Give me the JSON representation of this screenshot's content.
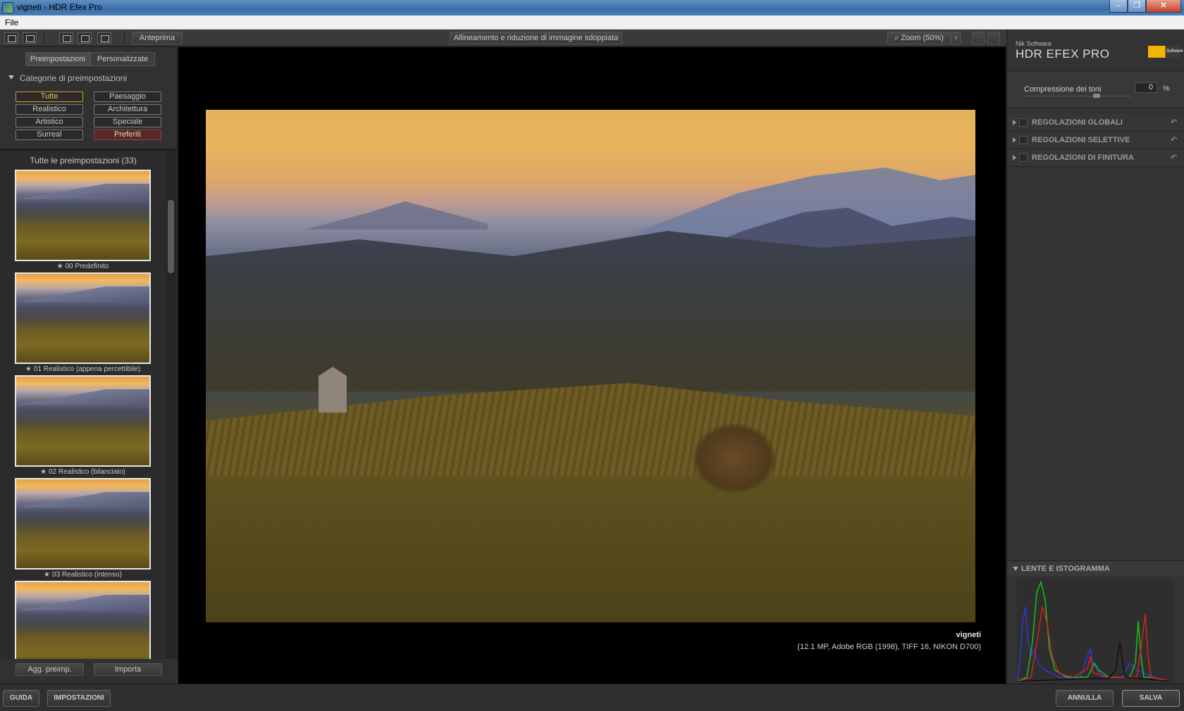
{
  "window": {
    "title": "vigneti - HDR Efex Pro",
    "min": "–",
    "max": "❐",
    "close": "✕"
  },
  "menu": {
    "file": "File"
  },
  "toolbar": {
    "preview": "Anteprima",
    "align": "Allineamento e riduzione di immagine sdoppiata",
    "zoom": "Zoom (50%)",
    "zoom_arrow": "›"
  },
  "left": {
    "tabs": [
      "Preimpostazioni",
      "Personalizzate"
    ],
    "categories_title": "Categorie di preimpostazioni",
    "categories": [
      "Tutte",
      "Paesaggio",
      "Realistico",
      "Architettura",
      "Artistico",
      "Speciale",
      "Surreal",
      "Preferiti"
    ],
    "list_title": "Tutte le preimpostazioni (33)",
    "presets": [
      "00 Predefinito",
      "01 Realistico (appena percettibile)",
      "02 Realistico (bilanciato)",
      "03 Realistico (intenso)"
    ],
    "star": "★",
    "add_preset": "Agg. preimp.",
    "import": "Importa"
  },
  "photo": {
    "name": "vigneti",
    "info": "(12.1 MP, Adobe RGB (1998), TIFF 16, NIKON D700)"
  },
  "right": {
    "brand_small": "Nik Software",
    "brand_title": "HDR EFEX PRO",
    "logo_text": "Software",
    "compression_label": "Compressione dei toni",
    "compression_value": "0",
    "compression_unit": "%",
    "sections": [
      "REGOLAZIONI GLOBALI",
      "REGOLAZIONI SELETTIVE",
      "REGOLAZIONI DI FINITURA"
    ],
    "undo": "↶",
    "histogram_title": "LENTE E ISTOGRAMMA"
  },
  "bottom": {
    "help": "GUIDA",
    "settings": "IMPOSTAZIONI",
    "cancel": "ANNULLA",
    "save": "SALVA"
  }
}
